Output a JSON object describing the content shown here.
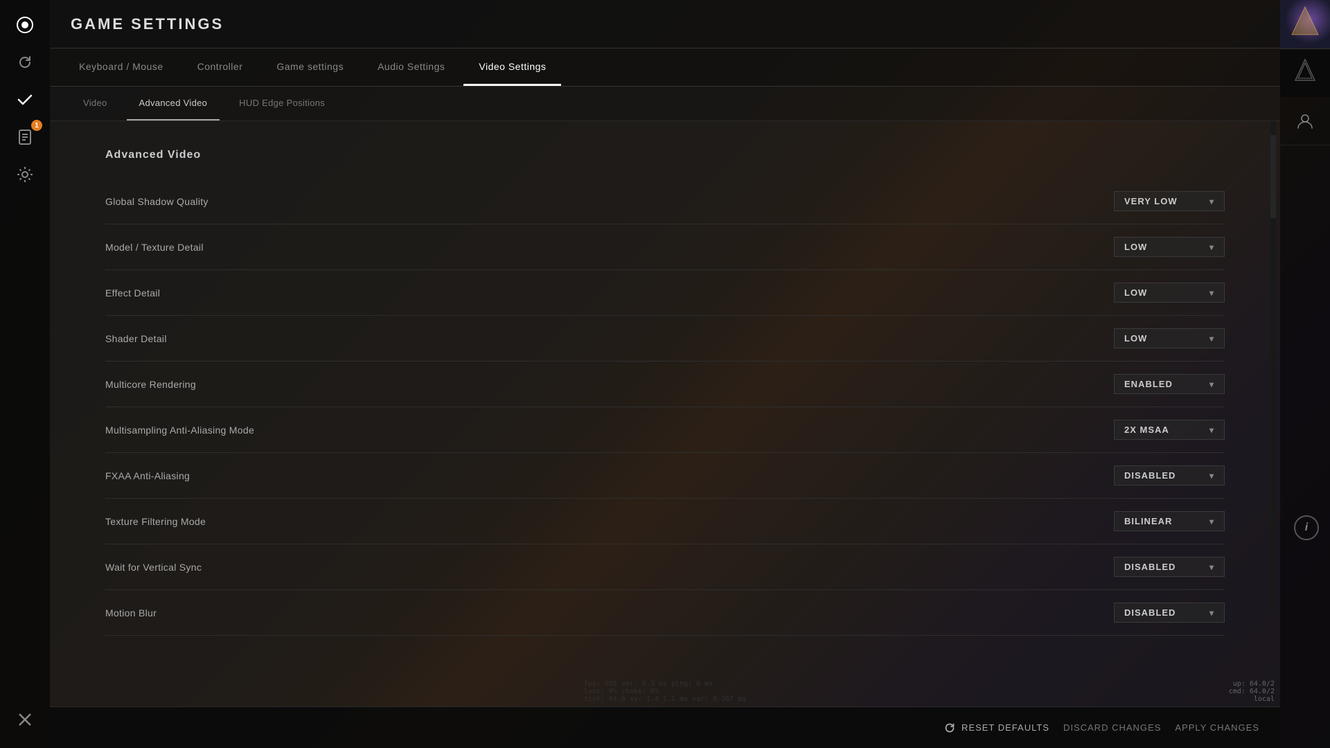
{
  "app": {
    "title": "GAME SETTINGS"
  },
  "sidebar": {
    "icons": [
      {
        "name": "home-icon",
        "symbol": "⟳",
        "active": false
      },
      {
        "name": "refresh-icon",
        "symbol": "↻",
        "active": false
      },
      {
        "name": "check-icon",
        "symbol": "✓",
        "active": false
      },
      {
        "name": "document-icon",
        "symbol": "📋",
        "active": false,
        "badge": "1"
      },
      {
        "name": "gear-icon",
        "symbol": "⚙",
        "active": false
      }
    ],
    "bottom_icon": {
      "name": "close-icon",
      "symbol": "✕"
    }
  },
  "topnav": {
    "tabs": [
      {
        "label": "Keyboard / Mouse",
        "active": false
      },
      {
        "label": "Controller",
        "active": false
      },
      {
        "label": "Game settings",
        "active": false
      },
      {
        "label": "Audio Settings",
        "active": false
      },
      {
        "label": "Video Settings",
        "active": true
      }
    ]
  },
  "subnav": {
    "tabs": [
      {
        "label": "Video",
        "active": false
      },
      {
        "label": "Advanced Video",
        "active": true
      },
      {
        "label": "HUD Edge Positions",
        "active": false
      }
    ]
  },
  "section": {
    "title": "Advanced Video",
    "settings": [
      {
        "label": "Global Shadow Quality",
        "value": "VERY LOW"
      },
      {
        "label": "Model / Texture Detail",
        "value": "LOW"
      },
      {
        "label": "Effect Detail",
        "value": "LOW"
      },
      {
        "label": "Shader Detail",
        "value": "LOW"
      },
      {
        "label": "Multicore Rendering",
        "value": "ENABLED"
      },
      {
        "label": "Multisampling Anti-Aliasing Mode",
        "value": "2X MSAA"
      },
      {
        "label": "FXAA Anti-Aliasing",
        "value": "DISABLED"
      },
      {
        "label": "Texture Filtering Mode",
        "value": "BILINEAR"
      },
      {
        "label": "Wait for Vertical Sync",
        "value": "DISABLED"
      },
      {
        "label": "Motion Blur",
        "value": "DISABLED"
      }
    ]
  },
  "bottombar": {
    "reset_label": "RESET DEFAULTS",
    "discard_label": "DISCARD CHANGES",
    "apply_label": "APPLY CHANGES"
  },
  "debug": {
    "line1": "fps:  288  var:  0.3 ms  ping: 0 ms",
    "line2": "loss:   0%  choke:  0%",
    "line3": "tick: 64.0  sv:  1.4  1.1 ms  var:  0.267 ms"
  },
  "debug_right": {
    "line1": "up: 64.0/2",
    "line2": "cmd: 64.0/2",
    "line3": "local"
  }
}
